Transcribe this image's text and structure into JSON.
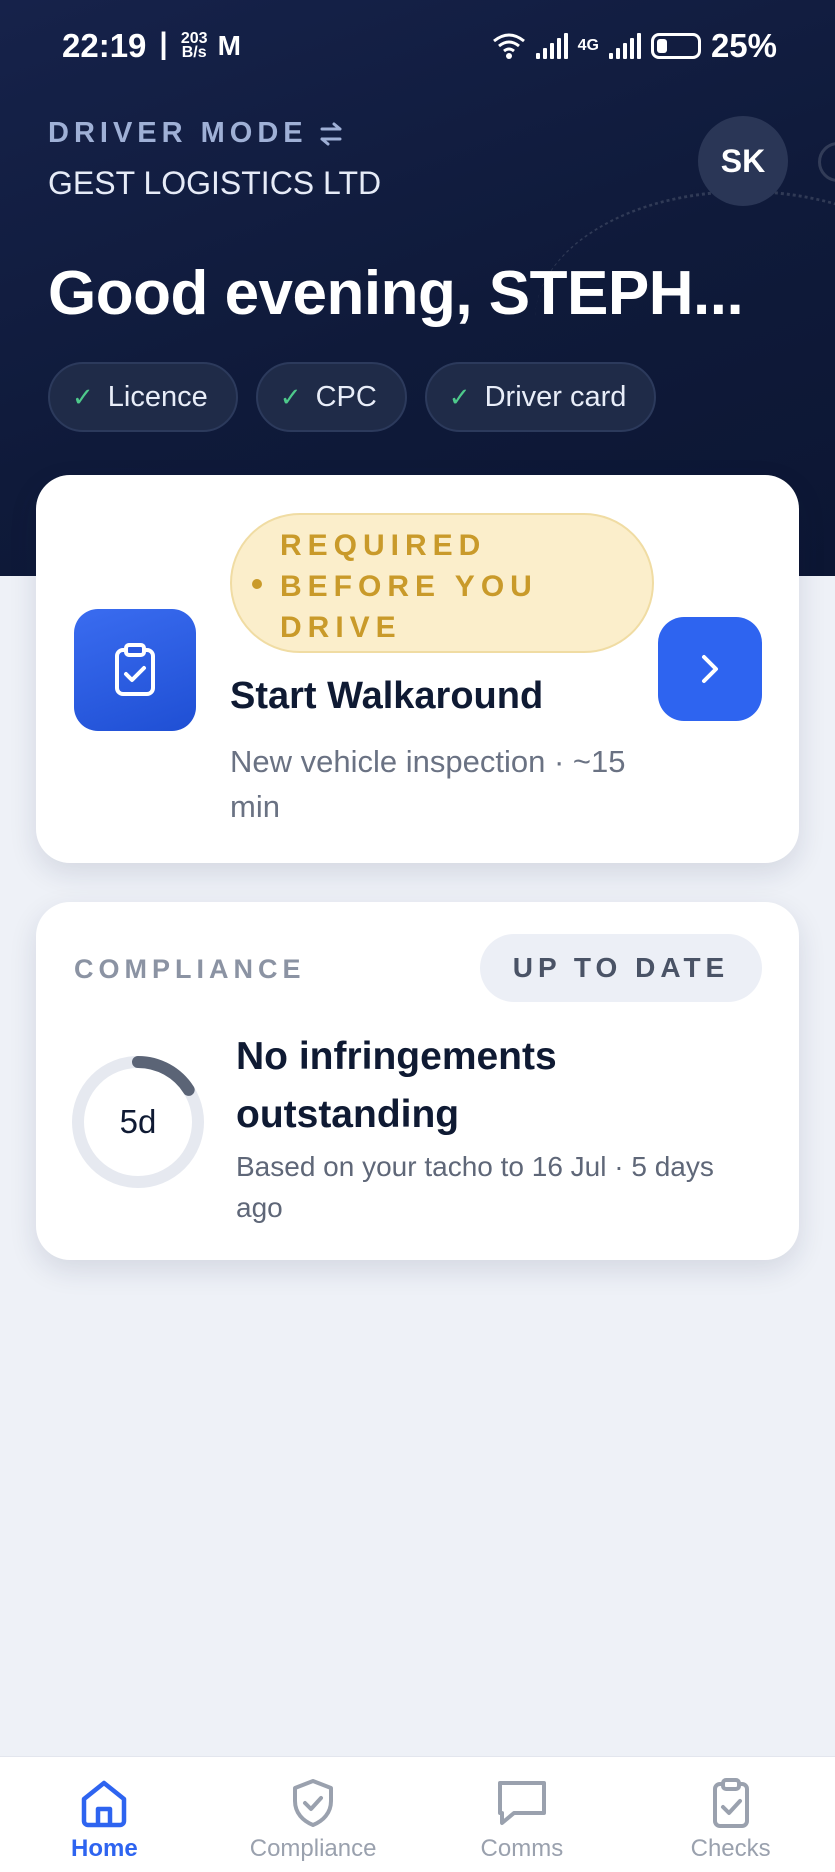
{
  "status_bar": {
    "time": "22:19",
    "net_speed_top": "203",
    "net_speed_bottom": "B/s",
    "sim_label": "4G",
    "battery": "25%"
  },
  "header": {
    "mode_label": "DRIVER MODE",
    "company": "GEST LOGISTICS LTD",
    "avatar_initials": "SK",
    "greeting": "Good evening, STEPH..."
  },
  "chips": [
    {
      "label": "Licence"
    },
    {
      "label": "CPC"
    },
    {
      "label": "Driver card"
    }
  ],
  "walkaround_card": {
    "badge_line1": "REQUIRED",
    "badge_line2": "BEFORE YOU",
    "badge_line3": "DRIVE",
    "title": "Start Walkaround",
    "subtitle": "New vehicle inspection · ~15 min",
    "icon": "clipboard-check-icon"
  },
  "compliance_card": {
    "label": "COMPLIANCE",
    "status_badge": "UP TO DATE",
    "ring_value": "5d",
    "ring_progress": 0.16,
    "title": "No infringements outstanding",
    "subtitle": "Based on your tacho to 16 Jul · 5 days ago"
  },
  "bottom_nav": [
    {
      "label": "Home",
      "icon": "home-icon",
      "active": true
    },
    {
      "label": "Compliance",
      "icon": "shield-check-icon",
      "active": false
    },
    {
      "label": "Comms",
      "icon": "chat-icon",
      "active": false
    },
    {
      "label": "Checks",
      "icon": "clipboard-check-icon",
      "active": false
    }
  ],
  "colors": {
    "hero_bg": "#0f1a3a",
    "accent": "#2e64f0",
    "warning_bg": "#fbeecb",
    "warning_text": "#c99a2a",
    "success": "#4ec98b"
  }
}
